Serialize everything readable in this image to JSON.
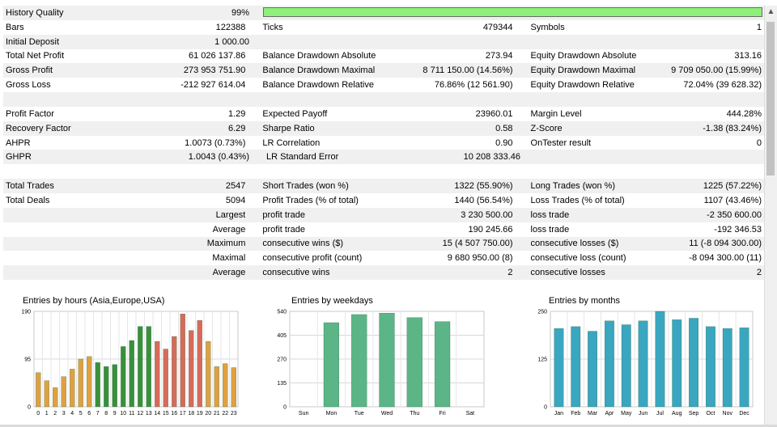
{
  "colors": {
    "shade": "#f0f0f0",
    "quality_bar": "#8ef07a",
    "hours_green": "#3a8f3a",
    "hours_red": "#d86a5a",
    "hours_orange": "#e0a040",
    "weekdays": "#5cb586",
    "months": "#3aa6bf"
  },
  "report": {
    "history_quality": {
      "label": "History Quality",
      "value": "99%",
      "level": 0.99
    },
    "bars": {
      "label": "Bars",
      "value": "122388"
    },
    "ticks": {
      "label": "Ticks",
      "value": "479344"
    },
    "symbols": {
      "label": "Symbols",
      "value": "1"
    },
    "initial_deposit": {
      "label": "Initial Deposit",
      "value": "1 000.00"
    },
    "total_net_profit": {
      "label": "Total Net Profit",
      "value": "61 026 137.86"
    },
    "balance_dd_abs": {
      "label": "Balance Drawdown Absolute",
      "value": "273.94"
    },
    "equity_dd_abs": {
      "label": "Equity Drawdown Absolute",
      "value": "313.16"
    },
    "gross_profit": {
      "label": "Gross Profit",
      "value": "273 953 751.90"
    },
    "balance_dd_max": {
      "label": "Balance Drawdown Maximal",
      "value": "8 711 150.00 (14.56%)"
    },
    "equity_dd_max": {
      "label": "Equity Drawdown Maximal",
      "value": "9 709 050.00 (15.99%)"
    },
    "gross_loss": {
      "label": "Gross Loss",
      "value": "-212 927 614.04"
    },
    "balance_dd_rel": {
      "label": "Balance Drawdown Relative",
      "value": "76.86% (12 561.90)"
    },
    "equity_dd_rel": {
      "label": "Equity Drawdown Relative",
      "value": "72.04% (39 628.32)"
    },
    "profit_factor": {
      "label": "Profit Factor",
      "value": "1.29"
    },
    "expected_payoff": {
      "label": "Expected Payoff",
      "value": "23960.01"
    },
    "margin_level": {
      "label": "Margin Level",
      "value": "444.28%"
    },
    "recovery_factor": {
      "label": "Recovery Factor",
      "value": "6.29"
    },
    "sharpe_ratio": {
      "label": "Sharpe Ratio",
      "value": "0.58"
    },
    "z_score": {
      "label": "Z-Score",
      "value": "-1.38 (83.24%)"
    },
    "ahpr": {
      "label": "AHPR",
      "value": "1.0073 (0.73%)"
    },
    "lr_correlation": {
      "label": "LR Correlation",
      "value": "0.90"
    },
    "ontester": {
      "label": "OnTester result",
      "value": "0"
    },
    "ghpr": {
      "label": "GHPR",
      "value": "1.0043 (0.43%)"
    },
    "lr_std_error": {
      "label": "LR Standard Error",
      "value": "10 208 333.46"
    },
    "total_trades": {
      "label": "Total Trades",
      "value": "2547"
    },
    "short_trades": {
      "label": "Short Trades (won %)",
      "value": "1322 (55.90%)"
    },
    "long_trades": {
      "label": "Long Trades (won %)",
      "value": "1225 (57.22%)"
    },
    "total_deals": {
      "label": "Total Deals",
      "value": "5094"
    },
    "profit_trades": {
      "label": "Profit Trades (% of total)",
      "value": "1440 (56.54%)"
    },
    "loss_trades": {
      "label": "Loss Trades (% of total)",
      "value": "1107 (43.46%)"
    },
    "largest": {
      "label": "Largest",
      "c2label": "profit trade",
      "c2value": "3 230 500.00",
      "c3label": "loss trade",
      "c3value": "-2 350 600.00"
    },
    "average": {
      "label": "Average",
      "c2label": "profit trade",
      "c2value": "190 245.66",
      "c3label": "loss trade",
      "c3value": "-192 346.53"
    },
    "maximum": {
      "label": "Maximum",
      "c2label": "consecutive wins ($)",
      "c2value": "15 (4 507 750.00)",
      "c3label": "consecutive losses ($)",
      "c3value": "11 (-8 094 300.00)"
    },
    "maximal": {
      "label": "Maximal",
      "c2label": "consecutive profit (count)",
      "c2value": "9 680 950.00 (8)",
      "c3label": "consecutive loss (count)",
      "c3value": "-8 094 300.00 (11)"
    },
    "average2": {
      "label": "Average",
      "c2label": "consecutive wins",
      "c2value": "2",
      "c3label": "consecutive losses",
      "c3value": "2"
    }
  },
  "chart_data": [
    {
      "type": "bar",
      "title": "Entries by hours (Asia,Europe,USA)",
      "categories": [
        "0",
        "1",
        "2",
        "3",
        "4",
        "5",
        "6",
        "7",
        "8",
        "9",
        "10",
        "11",
        "12",
        "13",
        "14",
        "15",
        "16",
        "17",
        "18",
        "19",
        "20",
        "21",
        "22",
        "23"
      ],
      "values": [
        68,
        52,
        38,
        60,
        75,
        95,
        100,
        88,
        80,
        84,
        120,
        132,
        160,
        160,
        130,
        115,
        140,
        185,
        152,
        172,
        130,
        80,
        86,
        78
      ],
      "ylim": [
        0,
        190
      ],
      "yticks": [
        "190",
        "95",
        "0"
      ]
    },
    {
      "type": "bar",
      "title": "Entries by weekdays",
      "categories": [
        "Sun",
        "Mon",
        "Tue",
        "Wed",
        "Thu",
        "Fri",
        "Sat"
      ],
      "values": [
        0,
        476,
        522,
        530,
        505,
        482,
        0
      ],
      "ylim": [
        0,
        540
      ],
      "yticks": [
        "540",
        "405",
        "270",
        "135",
        "0"
      ]
    },
    {
      "type": "bar",
      "title": "Entries by months",
      "categories": [
        "Jan",
        "Feb",
        "Mar",
        "Apr",
        "May",
        "Jun",
        "Jul",
        "Aug",
        "Sep",
        "Oct",
        "Nov",
        "Dec"
      ],
      "values": [
        205,
        210,
        198,
        225,
        215,
        225,
        250,
        228,
        232,
        210,
        205,
        207
      ],
      "ylim": [
        0,
        250
      ],
      "yticks": [
        "250",
        "125",
        "0"
      ]
    }
  ]
}
